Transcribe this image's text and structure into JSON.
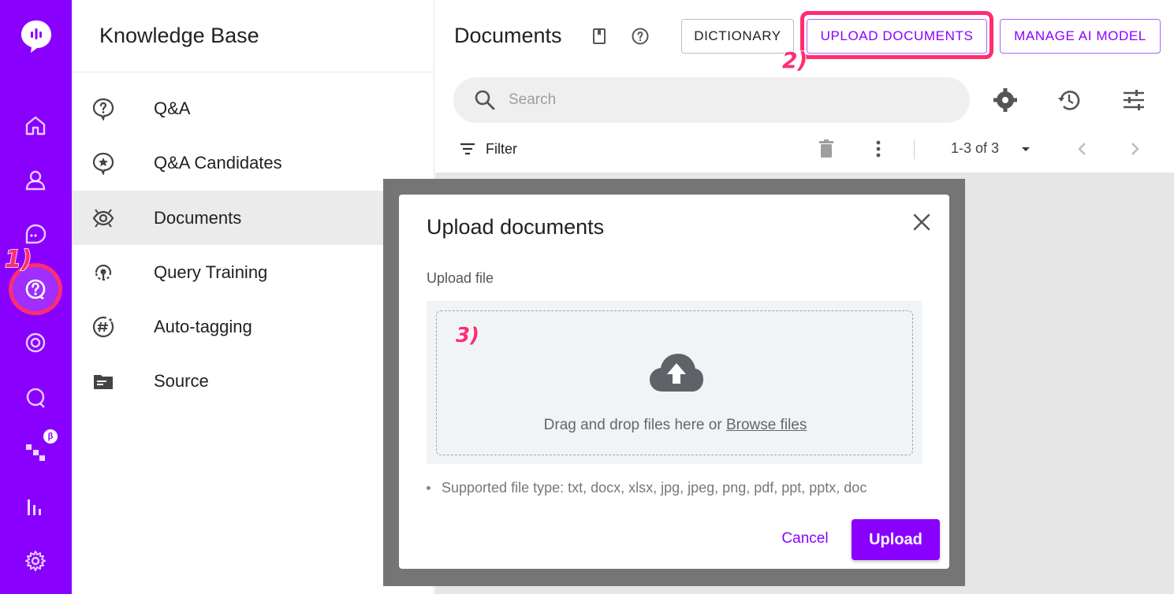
{
  "rail": {
    "items": [
      {
        "icon": "home-icon"
      },
      {
        "icon": "users-icon"
      },
      {
        "icon": "chat-icon"
      },
      {
        "icon": "knowledge-base-icon",
        "active": true
      },
      {
        "icon": "target-icon"
      },
      {
        "icon": "conversation-icon"
      },
      {
        "icon": "flow-icon",
        "badge": "β"
      },
      {
        "icon": "analytics-icon"
      },
      {
        "icon": "settings-icon"
      }
    ],
    "active_color": "#8a00ff"
  },
  "knowledge_base": {
    "title": "Knowledge Base",
    "items": [
      {
        "label": "Q&A",
        "icon": "question-bubble-icon"
      },
      {
        "label": "Q&A Candidates",
        "icon": "star-bubble-icon"
      },
      {
        "label": "Documents",
        "icon": "eye-icon",
        "active": true
      },
      {
        "label": "Query Training",
        "icon": "training-icon"
      },
      {
        "label": "Auto-tagging",
        "icon": "hashtag-icon"
      },
      {
        "label": "Source",
        "icon": "folder-icon"
      }
    ]
  },
  "documents": {
    "title": "Documents",
    "dictionary_label": "DICTIONARY",
    "upload_label": "UPLOAD DOCUMENTS",
    "manage_ai_label": "MANAGE AI MODEL",
    "search_placeholder": "Search",
    "filter_label": "Filter",
    "pagination": "1-3 of 3"
  },
  "dialog": {
    "title": "Upload documents",
    "upload_file_label": "Upload file",
    "drop_text": "Drag and drop files here or",
    "browse_link": "Browse files",
    "supported_types": "Supported file type: txt, docx, xlsx, jpg, jpeg, png, pdf, ppt, pptx, doc",
    "cancel_label": "Cancel",
    "upload_label": "Upload"
  },
  "annotations": {
    "step1": "1)",
    "step2": "2)",
    "step3": "3)",
    "highlight_color": "#ff2d6f"
  }
}
